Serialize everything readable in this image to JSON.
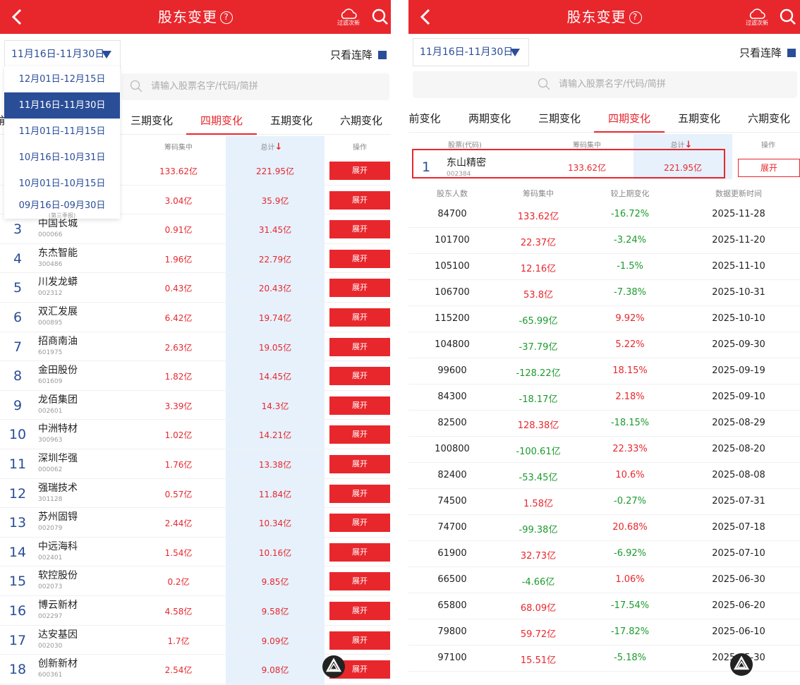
{
  "header": {
    "title": "股东变更",
    "help_glyph": "?",
    "filter_label": "过滤次新"
  },
  "left": {
    "date_button": "11月16日-11月30日",
    "only_cut": "只看连降",
    "search_placeholder": "请输入股票名字/代码/简拼",
    "tabs": [
      "前",
      "三期变化",
      "四期变化",
      "五期变化",
      "六期变化"
    ],
    "col_heads": {
      "chip": "筹码集中",
      "total": "总计",
      "action": "操作"
    },
    "dropdown": {
      "items": [
        "12月01日-12月15日",
        "11月16日-11月30日",
        "11月01日-11月15日",
        "10月16日-10月31日",
        "10月01日-10月15日",
        "09月16日-09月30日"
      ],
      "selected_index": 1,
      "sub_note": "(第三季报)"
    },
    "expand_label": "展开",
    "rows": [
      {
        "rank": "",
        "name": "",
        "code": "",
        "chip": "133.62亿",
        "total": "221.95亿"
      },
      {
        "rank": "",
        "name": "",
        "code": "",
        "chip": "3.04亿",
        "total": "35.9亿"
      },
      {
        "rank": "3",
        "name": "中国长城",
        "code": "000066",
        "chip": "0.91亿",
        "total": "31.45亿"
      },
      {
        "rank": "4",
        "name": "东杰智能",
        "code": "300486",
        "chip": "1.96亿",
        "total": "22.79亿"
      },
      {
        "rank": "5",
        "name": "川发龙蟒",
        "code": "002312",
        "chip": "0.43亿",
        "total": "20.43亿"
      },
      {
        "rank": "6",
        "name": "双汇发展",
        "code": "000895",
        "chip": "6.42亿",
        "total": "19.74亿"
      },
      {
        "rank": "7",
        "name": "招商南油",
        "code": "601975",
        "chip": "2.63亿",
        "total": "19.05亿"
      },
      {
        "rank": "8",
        "name": "金田股份",
        "code": "601609",
        "chip": "1.82亿",
        "total": "14.45亿"
      },
      {
        "rank": "9",
        "name": "龙佰集团",
        "code": "002601",
        "chip": "3.39亿",
        "total": "14.3亿"
      },
      {
        "rank": "10",
        "name": "中洲特材",
        "code": "300963",
        "chip": "1.02亿",
        "total": "14.21亿"
      },
      {
        "rank": "11",
        "name": "深圳华强",
        "code": "000062",
        "chip": "1.76亿",
        "total": "13.38亿"
      },
      {
        "rank": "12",
        "name": "强瑞技术",
        "code": "301128",
        "chip": "0.57亿",
        "total": "11.84亿"
      },
      {
        "rank": "13",
        "name": "苏州固锝",
        "code": "002079",
        "chip": "2.44亿",
        "total": "10.34亿"
      },
      {
        "rank": "14",
        "name": "中远海科",
        "code": "002401",
        "chip": "1.54亿",
        "total": "10.16亿"
      },
      {
        "rank": "15",
        "name": "软控股份",
        "code": "002073",
        "chip": "0.2亿",
        "total": "9.85亿"
      },
      {
        "rank": "16",
        "name": "博云新材",
        "code": "002297",
        "chip": "4.58亿",
        "total": "9.58亿"
      },
      {
        "rank": "17",
        "name": "达安基因",
        "code": "002030",
        "chip": "1.7亿",
        "total": "9.09亿"
      },
      {
        "rank": "18",
        "name": "创新新材",
        "code": "600361",
        "chip": "2.54亿",
        "total": "9.08亿"
      }
    ]
  },
  "right": {
    "date_button": "11月16日-11月30日",
    "only_cut": "只看连降",
    "search_placeholder": "请输入股票名字/代码/简拼",
    "tabs": [
      "前变化",
      "两期变化",
      "三期变化",
      "四期变化",
      "五期变化",
      "六期变化"
    ],
    "col_heads": {
      "stock": "股票(代码)",
      "chip": "筹码集中",
      "total": "总计",
      "action": "操作"
    },
    "selected": {
      "rank": "1",
      "name": "东山精密",
      "code": "002384",
      "chip": "133.62亿",
      "total": "221.95亿",
      "expand": "展开"
    },
    "sub_heads": [
      "股东人数",
      "筹码集中",
      "较上期变化",
      "数据更新时间"
    ],
    "history": [
      {
        "holders": "84700",
        "chip": "133.62亿",
        "chip_dir": "red",
        "change": "-16.72%",
        "change_dir": "green",
        "date": "2025-11-28"
      },
      {
        "holders": "101700",
        "chip": "22.37亿",
        "chip_dir": "red",
        "change": "-3.24%",
        "change_dir": "green",
        "date": "2025-11-20"
      },
      {
        "holders": "105100",
        "chip": "12.16亿",
        "chip_dir": "red",
        "change": "-1.5%",
        "change_dir": "green",
        "date": "2025-11-10"
      },
      {
        "holders": "106700",
        "chip": "53.8亿",
        "chip_dir": "red",
        "change": "-7.38%",
        "change_dir": "green",
        "date": "2025-10-31"
      },
      {
        "holders": "115200",
        "chip": "-65.99亿",
        "chip_dir": "green",
        "change": "9.92%",
        "change_dir": "red",
        "date": "2025-10-10"
      },
      {
        "holders": "104800",
        "chip": "-37.79亿",
        "chip_dir": "green",
        "change": "5.22%",
        "change_dir": "red",
        "date": "2025-09-30"
      },
      {
        "holders": "99600",
        "chip": "-128.22亿",
        "chip_dir": "green",
        "change": "18.15%",
        "change_dir": "red",
        "date": "2025-09-19"
      },
      {
        "holders": "84300",
        "chip": "-18.17亿",
        "chip_dir": "green",
        "change": "2.18%",
        "change_dir": "red",
        "date": "2025-09-10"
      },
      {
        "holders": "82500",
        "chip": "128.38亿",
        "chip_dir": "red",
        "change": "-18.15%",
        "change_dir": "green",
        "date": "2025-08-29"
      },
      {
        "holders": "100800",
        "chip": "-100.61亿",
        "chip_dir": "green",
        "change": "22.33%",
        "change_dir": "red",
        "date": "2025-08-20"
      },
      {
        "holders": "82400",
        "chip": "-53.45亿",
        "chip_dir": "green",
        "change": "10.6%",
        "change_dir": "red",
        "date": "2025-08-08"
      },
      {
        "holders": "74500",
        "chip": "1.58亿",
        "chip_dir": "red",
        "change": "-0.27%",
        "change_dir": "green",
        "date": "2025-07-31"
      },
      {
        "holders": "74700",
        "chip": "-99.38亿",
        "chip_dir": "green",
        "change": "20.68%",
        "change_dir": "red",
        "date": "2025-07-18"
      },
      {
        "holders": "61900",
        "chip": "32.73亿",
        "chip_dir": "red",
        "change": "-6.92%",
        "change_dir": "green",
        "date": "2025-07-10"
      },
      {
        "holders": "66500",
        "chip": "-4.66亿",
        "chip_dir": "green",
        "change": "1.06%",
        "change_dir": "red",
        "date": "2025-06-30"
      },
      {
        "holders": "65800",
        "chip": "68.09亿",
        "chip_dir": "red",
        "change": "-17.54%",
        "change_dir": "green",
        "date": "2025-06-20"
      },
      {
        "holders": "79800",
        "chip": "59.72亿",
        "chip_dir": "red",
        "change": "-17.82%",
        "change_dir": "green",
        "date": "2025-06-10"
      },
      {
        "holders": "97100",
        "chip": "15.51亿",
        "chip_dir": "red",
        "change": "-5.18%",
        "change_dir": "green",
        "date": "2025-05-30"
      }
    ]
  },
  "colors": {
    "brand_red": "#e8272d",
    "accent_blue": "#2a4d97",
    "highlight_col": "#e6f1fc",
    "rise": "#e8272d",
    "fall": "#1c9a2e"
  }
}
